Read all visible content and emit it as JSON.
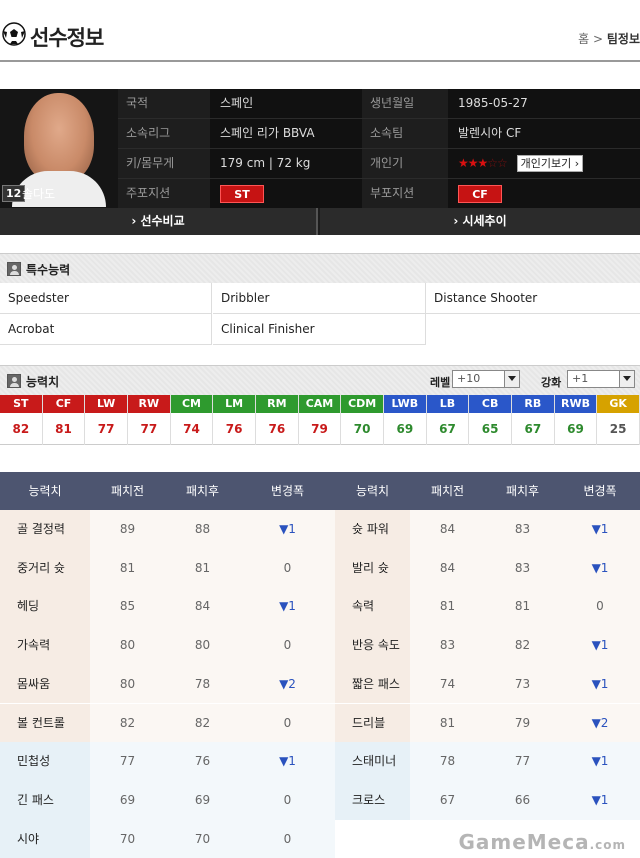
{
  "header": {
    "title": "선수정보",
    "crumb_home": "홈",
    "crumb_sep": ">",
    "crumb_current": "팀정보"
  },
  "player": {
    "number": "12",
    "name": "솔다도",
    "rows": [
      {
        "l1": "국적",
        "v1": "스페인",
        "l2": "생년월일",
        "v2": "1985-05-27"
      },
      {
        "l1": "소속리그",
        "v1": "스페인 리가 BBVA",
        "l2": "소속팀",
        "v2": "발렌시아 CF"
      },
      {
        "l1": "키/몸무게",
        "v1": "179 cm | 72 kg",
        "l2": "개인기",
        "v2": ""
      },
      {
        "l1": "주포지션",
        "v1": "",
        "l2": "부포지션",
        "v2": ""
      }
    ],
    "skill_stars": {
      "filled": "★★★",
      "empty": "☆☆",
      "count": 3,
      "max": 5
    },
    "skill_button": "개인기보기 ›",
    "main_position": "ST",
    "sub_position": "CF"
  },
  "tabs": [
    "› 선수비교",
    "› 시세추이"
  ],
  "special": {
    "title": "특수능력",
    "items": [
      "Speedster",
      "Dribbler",
      "Distance Shooter",
      "Acrobat",
      "Clinical Finisher"
    ]
  },
  "abilities": {
    "title": "능력치",
    "level_label": "레벨",
    "level_value": "+10",
    "enhance_label": "강화",
    "enhance_value": "+1",
    "positions": [
      {
        "code": "ST",
        "value": "82",
        "color": "#c81a1a",
        "vcolor": "#c81a1a"
      },
      {
        "code": "CF",
        "value": "81",
        "color": "#c81a1a",
        "vcolor": "#c81a1a"
      },
      {
        "code": "LW",
        "value": "77",
        "color": "#c81a1a",
        "vcolor": "#c81a1a"
      },
      {
        "code": "RW",
        "value": "77",
        "color": "#c81a1a",
        "vcolor": "#c81a1a"
      },
      {
        "code": "CM",
        "value": "74",
        "color": "#2e9a2e",
        "vcolor": "#c81a1a"
      },
      {
        "code": "LM",
        "value": "76",
        "color": "#2e9a2e",
        "vcolor": "#c81a1a"
      },
      {
        "code": "RM",
        "value": "76",
        "color": "#2e9a2e",
        "vcolor": "#c81a1a"
      },
      {
        "code": "CAM",
        "value": "79",
        "color": "#2e9a2e",
        "vcolor": "#c81a1a"
      },
      {
        "code": "CDM",
        "value": "70",
        "color": "#2e9a2e",
        "vcolor": "#2e8a2e"
      },
      {
        "code": "LWB",
        "value": "69",
        "color": "#2a57c9",
        "vcolor": "#2e8a2e"
      },
      {
        "code": "LB",
        "value": "67",
        "color": "#2a57c9",
        "vcolor": "#2e8a2e"
      },
      {
        "code": "CB",
        "value": "65",
        "color": "#2a57c9",
        "vcolor": "#2e8a2e"
      },
      {
        "code": "RB",
        "value": "67",
        "color": "#2a57c9",
        "vcolor": "#2e8a2e"
      },
      {
        "code": "RWB",
        "value": "69",
        "color": "#2a57c9",
        "vcolor": "#2e8a2e"
      },
      {
        "code": "GK",
        "value": "25",
        "color": "#d6a200",
        "vcolor": "#555555"
      }
    ]
  },
  "stats": {
    "headers": [
      "능력치",
      "패치전",
      "패치후",
      "변경폭",
      "능력치",
      "패치전",
      "패치후",
      "변경폭"
    ],
    "rows": [
      {
        "left": {
          "name": "골 결정력",
          "before": "89",
          "after": "88",
          "change": "▼1"
        },
        "right": {
          "name": "슛 파워",
          "before": "84",
          "after": "83",
          "change": "▼1"
        },
        "tone": "warm"
      },
      {
        "left": {
          "name": "중거리 슛",
          "before": "81",
          "after": "81",
          "change": "0"
        },
        "right": {
          "name": "발리 슛",
          "before": "84",
          "after": "83",
          "change": "▼1"
        },
        "tone": "warm"
      },
      {
        "left": {
          "name": "헤딩",
          "before": "85",
          "after": "84",
          "change": "▼1"
        },
        "right": {
          "name": "속력",
          "before": "81",
          "after": "81",
          "change": "0"
        },
        "tone": "warm"
      },
      {
        "left": {
          "name": "가속력",
          "before": "80",
          "after": "80",
          "change": "0"
        },
        "right": {
          "name": "반응 속도",
          "before": "83",
          "after": "82",
          "change": "▼1"
        },
        "tone": "warm"
      },
      {
        "left": {
          "name": "몸싸움",
          "before": "80",
          "after": "78",
          "change": "▼2"
        },
        "right": {
          "name": "짧은 패스",
          "before": "74",
          "after": "73",
          "change": "▼1"
        },
        "tone": "warm"
      },
      {
        "left": {
          "name": "볼 컨트롤",
          "before": "82",
          "after": "82",
          "change": "0"
        },
        "right": {
          "name": "드리블",
          "before": "81",
          "after": "79",
          "change": "▼2"
        },
        "tone": "warm"
      },
      {
        "left": {
          "name": "민첩성",
          "before": "77",
          "after": "76",
          "change": "▼1"
        },
        "right": {
          "name": "스태미너",
          "before": "78",
          "after": "77",
          "change": "▼1"
        },
        "tone": "cool"
      },
      {
        "left": {
          "name": "긴 패스",
          "before": "69",
          "after": "69",
          "change": "0"
        },
        "right": {
          "name": "크로스",
          "before": "67",
          "after": "66",
          "change": "▼1"
        },
        "tone": "cool"
      },
      {
        "left": {
          "name": "시야",
          "before": "70",
          "after": "70",
          "change": "0"
        },
        "right": null,
        "tone": "cool"
      }
    ]
  },
  "watermark": {
    "main": "GameMeca",
    "sub": ".com"
  }
}
